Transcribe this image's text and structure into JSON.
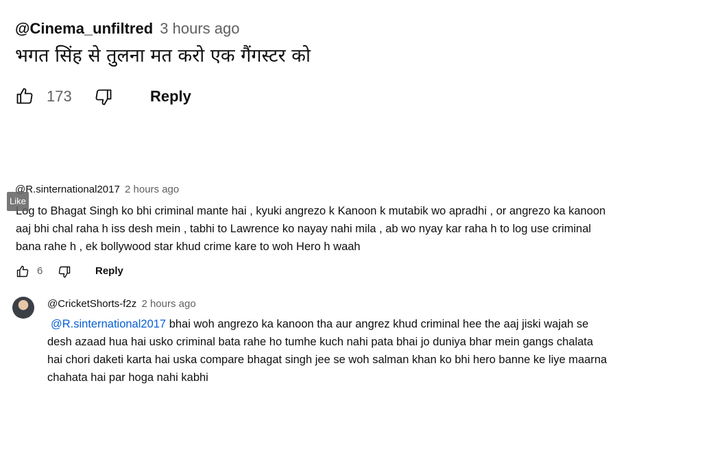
{
  "comment1": {
    "handle": "@Cinema_unfiltred",
    "time": "3 hours ago",
    "text": "भगत सिंह से तुलना मत करो एक गैंगस्टर को",
    "likes": "173",
    "reply_label": "Reply"
  },
  "comment2": {
    "handle": "@R.sinternational2017",
    "time": "2 hours ago",
    "tooltip": "Like",
    "text_lines": [
      "Log to Bhagat Singh ko bhi criminal mante hai , kyuki angrezo k Kanoon k mutabik wo apradhi , or angrezo ka kanoon",
      "aaj bhi chal raha h iss desh mein , tabhi to Lawrence ko nayay nahi mila , ab wo nyay kar raha h to log use criminal",
      "bana rahe h , ek bollywood star khud crime kare to woh Hero h waah"
    ],
    "likes": "6",
    "reply_label": "Reply"
  },
  "reply1": {
    "handle": "@CricketShorts-f2z",
    "time": "2 hours ago",
    "mention": "@R.sinternational2017",
    "line1_rest": " bhai woh angrezo ka kanoon tha aur angrez khud criminal hee the aaj jiski wajah se",
    "text_lines": [
      "desh azaad hua hai usko criminal bata rahe ho tumhe kuch nahi pata bhai jo duniya bhar mein gangs chalata",
      "hai chori daketi karta hai uska compare bhagat singh jee se woh salman khan ko bhi hero banne ke liye maarna",
      "chahata hai par hoga nahi kabhi"
    ]
  },
  "icons": {
    "like": "thumbs-up-icon",
    "dislike": "thumbs-down-icon"
  }
}
